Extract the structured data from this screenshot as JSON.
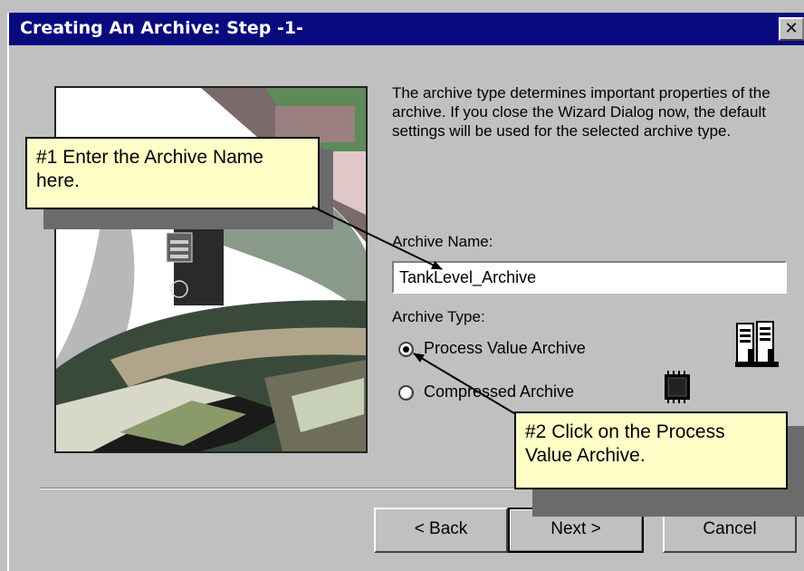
{
  "window": {
    "title": "Creating An Archive: Step -1-",
    "close_label": "✕"
  },
  "description": "The archive type determines important properties of the archive. If you close the Wizard Dialog now, the default settings will be used for the selected archive type.",
  "archive_name": {
    "label": "Archive Name:",
    "value": "TankLevel_Archive"
  },
  "archive_type": {
    "label": "Archive Type:",
    "options": [
      {
        "label": "Process Value Archive",
        "selected": true,
        "icon": "binders-icon"
      },
      {
        "label": "Compressed Archive",
        "selected": false,
        "icon": "chip-icon"
      }
    ]
  },
  "buttons": {
    "back": "< Back",
    "next": "Next >",
    "cancel": "Cancel"
  },
  "callouts": {
    "one": "#1 Enter the Archive Name here.",
    "two": "#2 Click on the Process Value Archive."
  },
  "colors": {
    "titlebar": "#0a0a80",
    "dialog": "#c0c0c0",
    "callout": "#ffffc8"
  }
}
